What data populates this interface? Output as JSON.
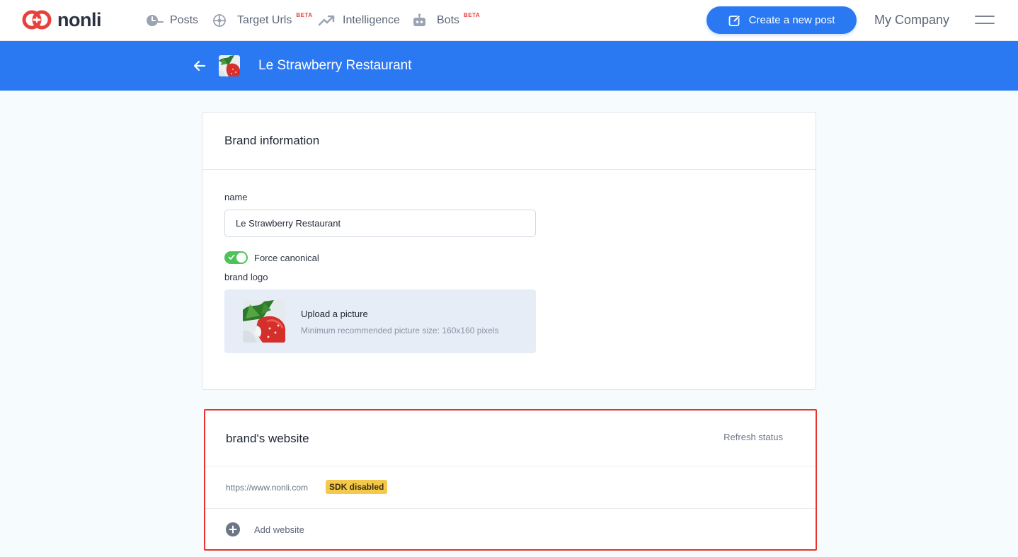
{
  "nav": {
    "logo_text": "nonli",
    "items": [
      {
        "label": "Posts",
        "badge": "",
        "icon": "posts-icon"
      },
      {
        "label": "Target Urls",
        "badge": "BETA",
        "icon": "target-icon"
      },
      {
        "label": "Intelligence",
        "badge": "",
        "icon": "trend-icon"
      },
      {
        "label": "Bots",
        "badge": "BETA",
        "icon": "bot-icon"
      }
    ],
    "create_button": "Create a new post",
    "company": "My Company"
  },
  "brand_bar": {
    "title": "Le Strawberry Restaurant"
  },
  "brand_info": {
    "title": "Brand information",
    "name_label": "name",
    "name_value": "Le Strawberry Restaurant",
    "force_canonical_label": "Force canonical",
    "force_canonical_on": true,
    "logo_label": "brand logo",
    "upload_title": "Upload a picture",
    "upload_hint": "Minimum recommended picture size: 160x160 pixels"
  },
  "website": {
    "title": "brand's website",
    "refresh_label": "Refresh status",
    "sites": [
      {
        "url": "https://www.nonli.com",
        "status": "SDK disabled"
      }
    ],
    "add_label": "Add website"
  },
  "colors": {
    "primary": "#2a78f2",
    "logo_red": "#e8403a",
    "toggle_on": "#4cc25a",
    "badge_warning": "#f4c84a",
    "highlight_border": "#e8322a"
  }
}
